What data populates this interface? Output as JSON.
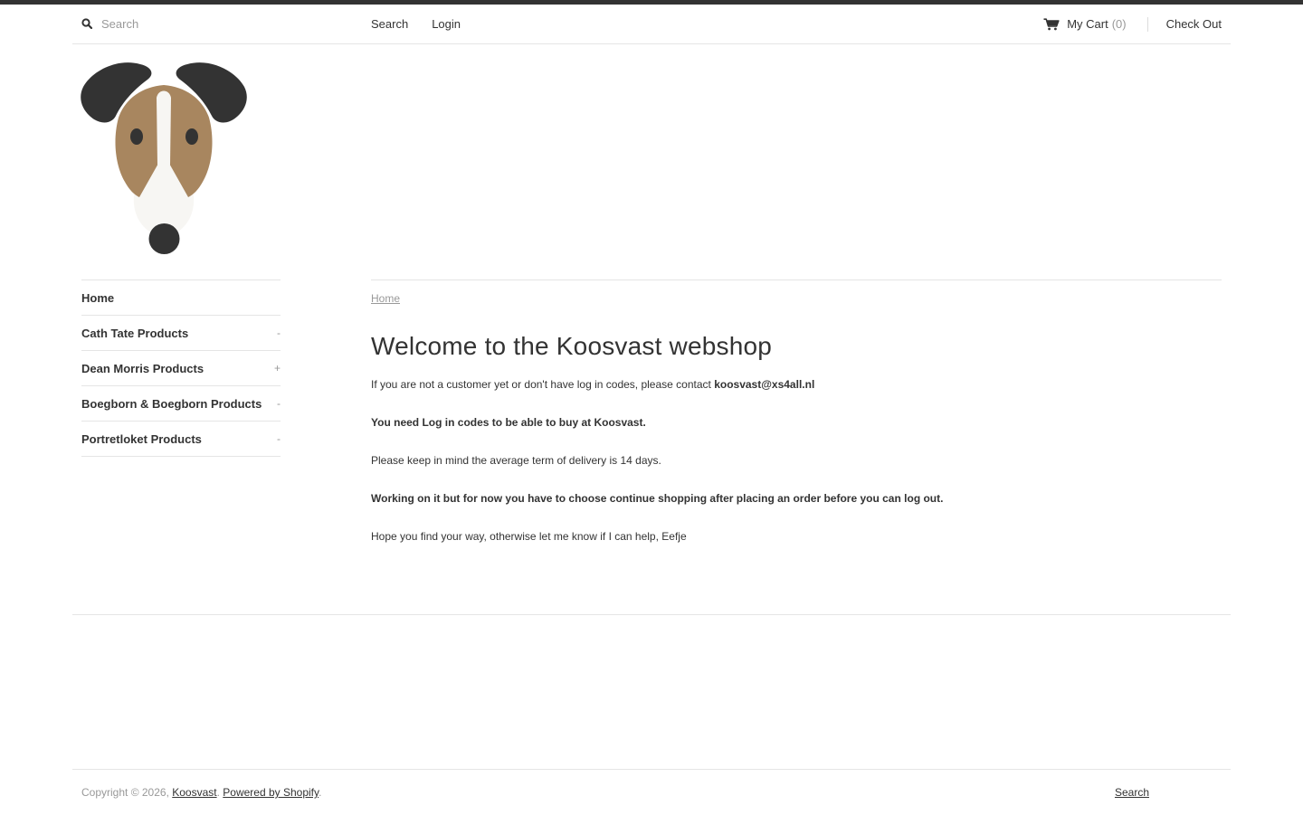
{
  "header": {
    "search_placeholder": "Search",
    "links": [
      "Search",
      "Login"
    ],
    "cart_label": "My Cart",
    "cart_count": "(0)",
    "checkout_label": "Check Out"
  },
  "logo": {
    "icon": "dog-head-logo",
    "colors": {
      "ears": "#333333",
      "face": "#a8865f",
      "muzzle": "#f7f6f3",
      "nose": "#333333"
    }
  },
  "sidebar": {
    "items": [
      {
        "label": "Home",
        "toggle": ""
      },
      {
        "label": "Cath Tate Products",
        "toggle": "-"
      },
      {
        "label": "Dean Morris Products",
        "toggle": "+"
      },
      {
        "label": "Boegborn & Boegborn Products",
        "toggle": "-"
      },
      {
        "label": "Portretloket Products",
        "toggle": "-"
      }
    ]
  },
  "main": {
    "breadcrumb": "Home",
    "title": "Welcome to the Koosvast webshop",
    "p1_text": "If you are not a customer yet or don't have log in codes, please contact",
    "p1_email": "koosvast@xs4all.nl",
    "p2": "You need Log in codes to be able to buy at Koosvast.",
    "p3": "Please keep in mind the average term of delivery is 14 days.",
    "p4": "Working on it but for now you have to choose continue shopping after placing an order before you can log out.",
    "p5": "Hope you find your way, otherwise let me know if I can help, Eefje"
  },
  "footer": {
    "copyright": "Copyright © 2026,",
    "shop_name": "Koosvast",
    "powered_by": "Powered by Shopify",
    "search_link": "Search"
  },
  "colors": {
    "text": "#333333",
    "muted": "#999999",
    "border": "#e5e5e5",
    "topbar": "#333333"
  }
}
